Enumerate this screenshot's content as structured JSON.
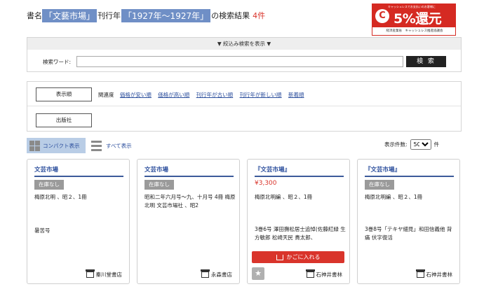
{
  "header": {
    "prefix": "書名",
    "title_query": "「文藝市場」",
    "mid": "刊行年",
    "year_query": "「1927年〜1927年」",
    "suffix": "の検索結果",
    "count": "4件"
  },
  "banner": {
    "top_text": "キャッシュレスでお支払いのお客様に",
    "big_text": "5%還元",
    "foot_text": "経済産業省　キャッシュレス推進協議会",
    "logo_icon": "cashless-logo-icon",
    "color": "#d52a22"
  },
  "search": {
    "refine_label": "▼ 絞込み検索を表示 ▼",
    "keyword_label": "検索ワード:",
    "keyword_value": "",
    "button_label": "検 索"
  },
  "sort": {
    "display_order_button": "表示順",
    "publisher_button": "出版社",
    "relevance_label": "関連度",
    "options": [
      "価格が安い順",
      "価格が高い順",
      "刊行年が古い順",
      "刊行年が新しい順",
      "新着順"
    ]
  },
  "view": {
    "compact_label": "コンパクト表示",
    "all_label": "すべて表示",
    "per_page_label": "表示件数:",
    "per_page_value": "50",
    "per_page_unit": "件",
    "active_color": "#b9cde6"
  },
  "cards": [
    {
      "title": "文芸市場",
      "badge": "在庫なし",
      "desc": "梅原北明 、昭２、1冊",
      "note": "暑苦号",
      "store": "秦川堂書店"
    },
    {
      "title": "文芸市場",
      "badge": "在庫なし",
      "desc": "昭和二年六月号～九、十月号 4冊 梅原北明 文芸市場社 、昭2",
      "note": "",
      "store": "永森書店"
    },
    {
      "title": "『文芸市場』",
      "price": "¥3,300",
      "desc": "梅原北明編 、昭２、1冊",
      "note": "3巻6号 澤田撫松居士追悼(佐藤紅緑 生方敏郎 松崎天民 貴太郎、",
      "cart_label": "かごに入れる",
      "store": "石神井書林"
    },
    {
      "title": "『文芸市場』",
      "badge": "在庫なし",
      "desc": "梅原北明編 、昭２、1冊",
      "note": "3巻8号「テキヤ細見」和田信義他 背痛 伏字復活",
      "store": "石神井書林"
    }
  ]
}
